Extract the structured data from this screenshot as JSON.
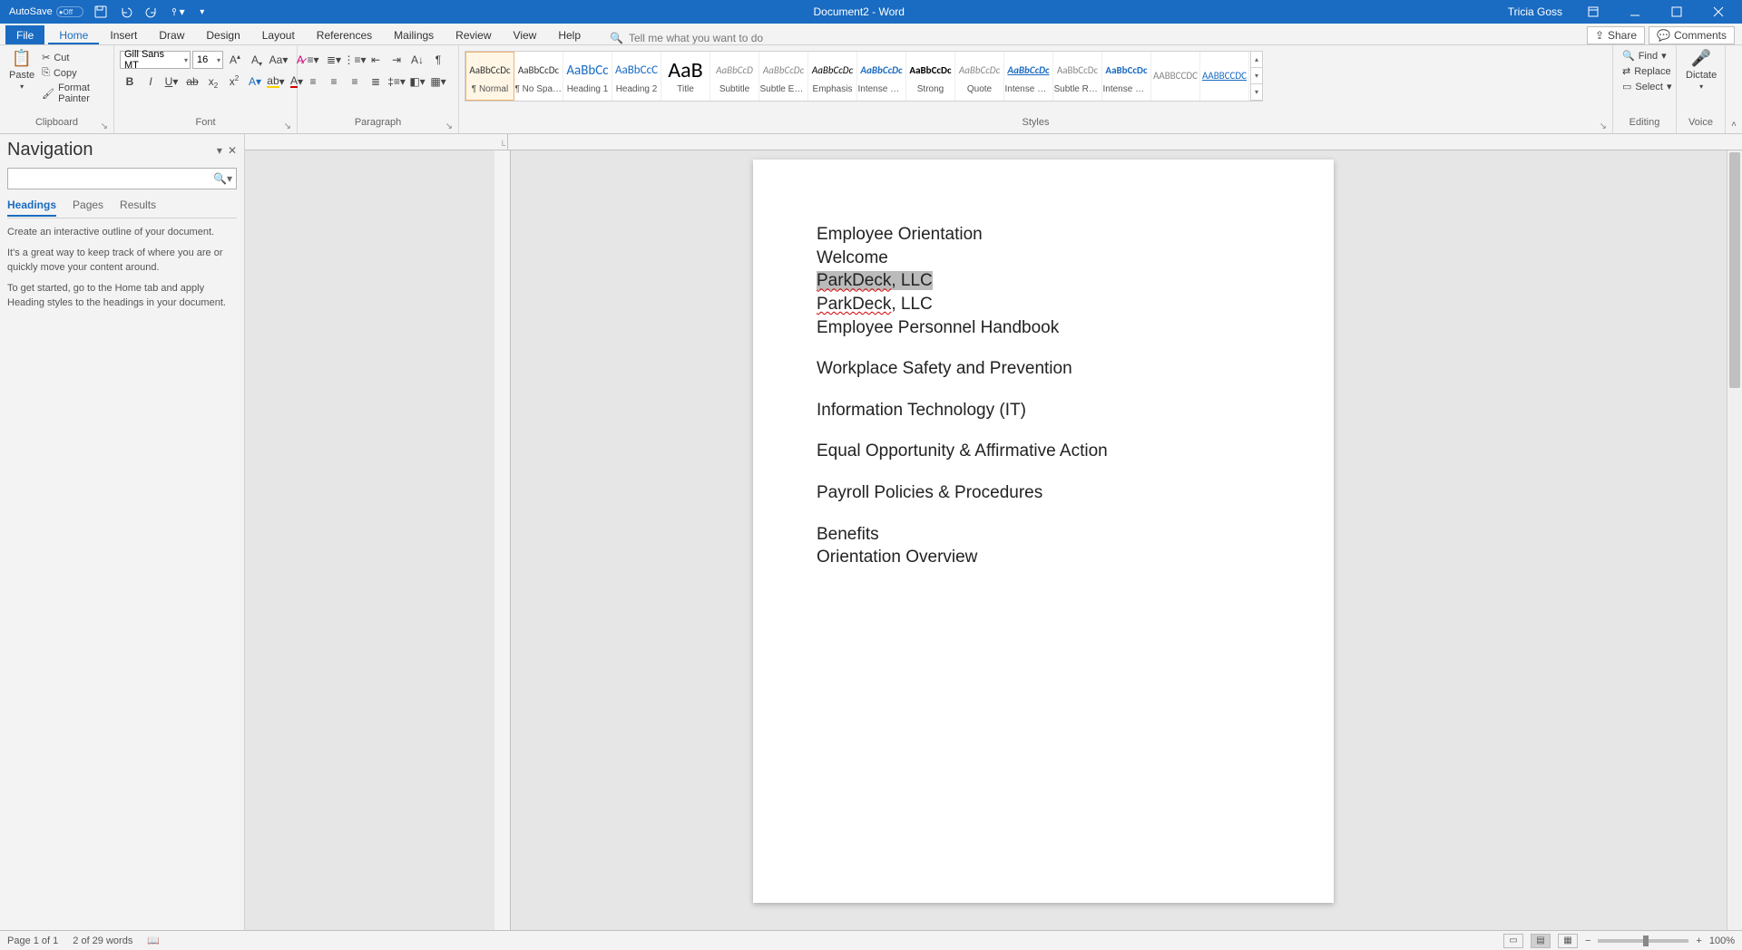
{
  "title_bar": {
    "autosave_label": "AutoSave",
    "autosave_state": "Off",
    "doc_title": "Document2 - Word",
    "user_name": "Tricia Goss"
  },
  "ribbon_tabs": {
    "file": "File",
    "tabs": [
      "Home",
      "Insert",
      "Draw",
      "Design",
      "Layout",
      "References",
      "Mailings",
      "Review",
      "View",
      "Help"
    ],
    "active": "Home",
    "tellme_placeholder": "Tell me what you want to do",
    "share": "Share",
    "comments": "Comments"
  },
  "clipboard": {
    "paste": "Paste",
    "cut": "Cut",
    "copy": "Copy",
    "format_painter": "Format Painter",
    "group": "Clipboard"
  },
  "font": {
    "name": "Gill Sans MT",
    "size": "16",
    "group": "Font"
  },
  "paragraph": {
    "group": "Paragraph"
  },
  "styles_group": {
    "group": "Styles",
    "items": [
      {
        "preview": "AaBbCcDc",
        "name": "¶ Normal",
        "sel": true,
        "cls": ""
      },
      {
        "preview": "AaBbCcDc",
        "name": "¶ No Spac…",
        "cls": ""
      },
      {
        "preview": "AaBbCc",
        "name": "Heading 1",
        "cls": "h1"
      },
      {
        "preview": "AaBbCcC",
        "name": "Heading 2",
        "cls": "h2"
      },
      {
        "preview": "AaB",
        "name": "Title",
        "cls": "ttl"
      },
      {
        "preview": "AaBbCcD",
        "name": "Subtitle",
        "cls": "sub"
      },
      {
        "preview": "AaBbCcDc",
        "name": "Subtle Em…",
        "cls": "se"
      },
      {
        "preview": "AaBbCcDc",
        "name": "Emphasis",
        "cls": "em"
      },
      {
        "preview": "AaBbCcDc",
        "name": "Intense E…",
        "cls": "ie"
      },
      {
        "preview": "AaBbCcDc",
        "name": "Strong",
        "cls": "st"
      },
      {
        "preview": "AaBbCcDc",
        "name": "Quote",
        "cls": "qt"
      },
      {
        "preview": "AaBbCcDc",
        "name": "Intense Q…",
        "cls": "iq"
      },
      {
        "preview": "AaBbCcDc",
        "name": "Subtle Ref…",
        "cls": "sr"
      },
      {
        "preview": "AaBbCcDc",
        "name": "Intense Re…",
        "cls": "ir"
      },
      {
        "preview": "AABBCCDC",
        "name": "",
        "cls": "br"
      },
      {
        "preview": "AABBCCDC",
        "name": "",
        "cls": "ln"
      }
    ]
  },
  "editing": {
    "group": "Editing",
    "find": "Find",
    "replace": "Replace",
    "select": "Select"
  },
  "voice": {
    "group": "Voice",
    "dictate": "Dictate"
  },
  "nav": {
    "title": "Navigation",
    "search_placeholder": "",
    "tabs": [
      "Headings",
      "Pages",
      "Results"
    ],
    "active": "Headings",
    "hint1": "Create an interactive outline of your document.",
    "hint2": "It's a great way to keep track of where you are or quickly move your content around.",
    "hint3": "To get started, go to the Home tab and apply Heading styles to the headings in your document."
  },
  "document": {
    "lines": [
      "Employee Orientation",
      "Welcome",
      "ParkDeck, LLC",
      "ParkDeck, LLC",
      "Employee Personnel Handbook",
      "Workplace Safety and Prevention",
      "Information Technology (IT)",
      "Equal Opportunity & Affirmative Action",
      "Payroll Policies & Procedures",
      "Benefits",
      "Orientation Overview"
    ],
    "selected_line_index": 2,
    "gap_before": [
      5,
      6,
      7,
      8,
      9
    ],
    "spellcheck_word": "ParkDeck"
  },
  "status": {
    "page": "Page 1 of 1",
    "words": "2 of 29 words",
    "zoom": "100%"
  }
}
